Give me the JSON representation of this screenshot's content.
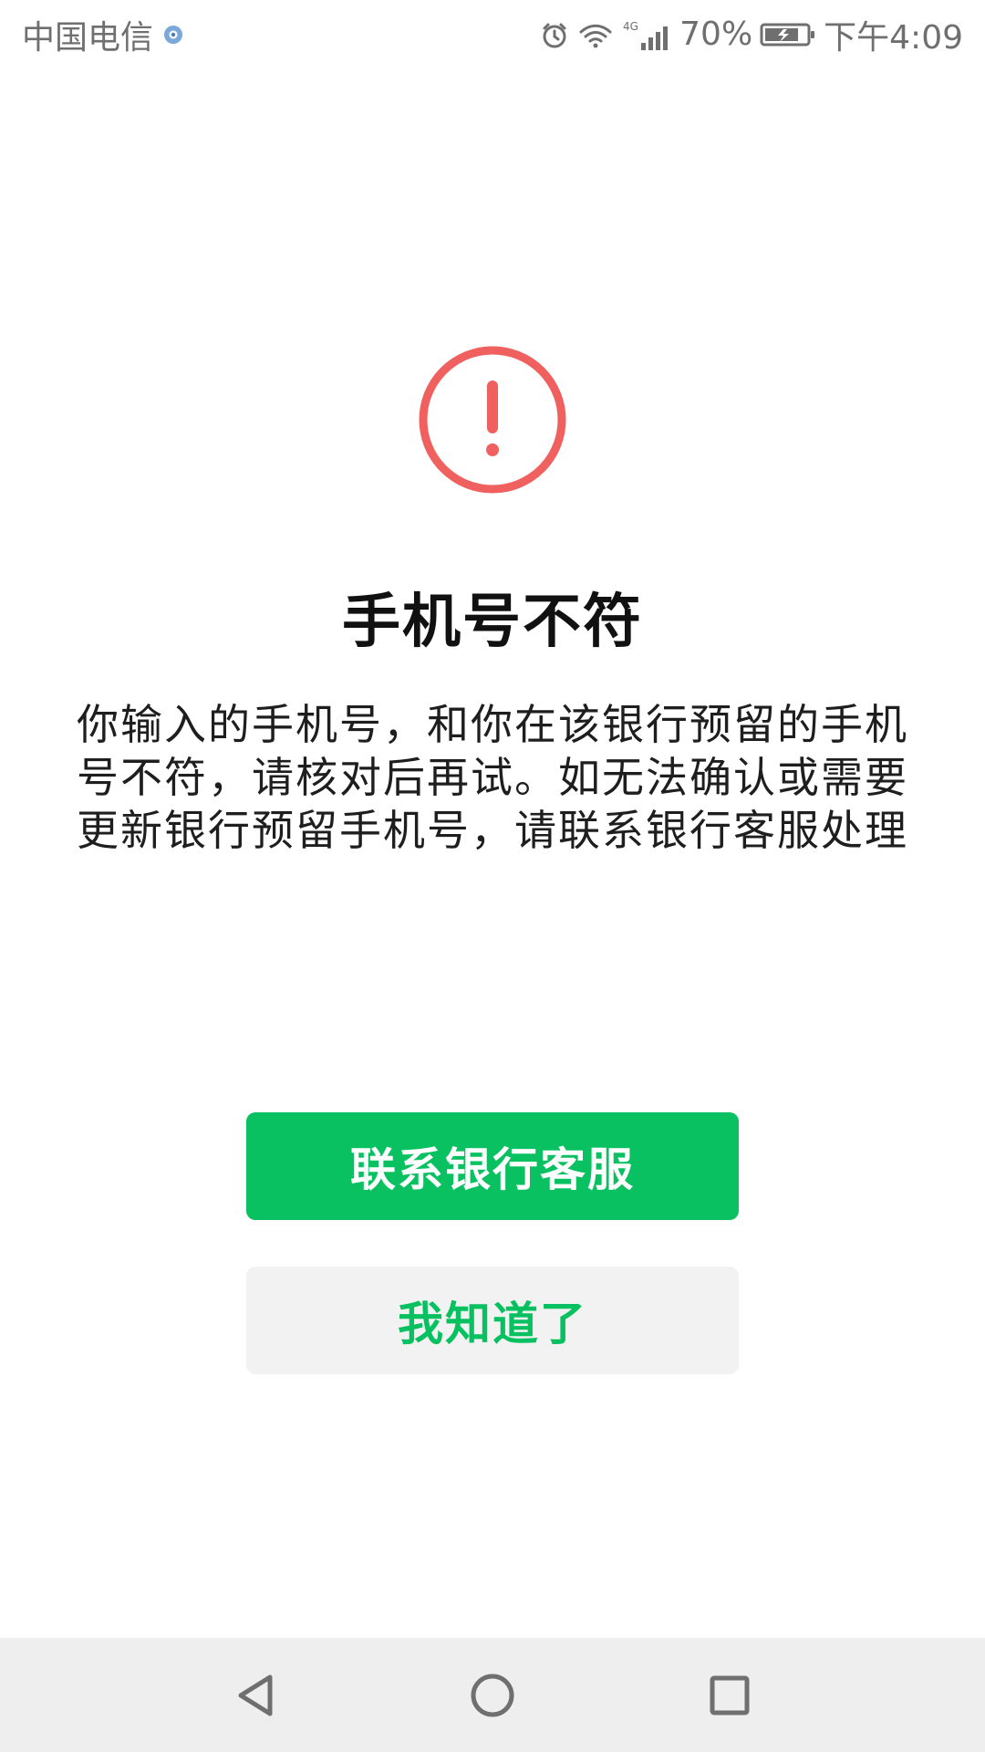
{
  "status_bar": {
    "carrier": "中国电信",
    "network": "4G",
    "battery": "70%",
    "time": "下午4:09",
    "icons": [
      "eye-protect-icon",
      "alarm-icon",
      "wifi-icon",
      "signal-icon",
      "battery-icon"
    ]
  },
  "dialog": {
    "title": "手机号不符",
    "message": "你输入的手机号，和你在该银行预留的手机号不符，请核对后再试。如无法确认或需要更新银行预留手机号，请联系银行客服处理",
    "primary_button": "联系银行客服",
    "secondary_button": "我知道了",
    "icon": "warning-icon"
  },
  "colors": {
    "warning": "#F0605E",
    "primary": "#09C160",
    "secondary_bg": "#F2F2F2",
    "secondary_text": "#07C160",
    "nav_bg": "#EEEEEE"
  },
  "nav_bar": {
    "icons": [
      "back-icon",
      "home-icon",
      "recents-icon"
    ]
  }
}
